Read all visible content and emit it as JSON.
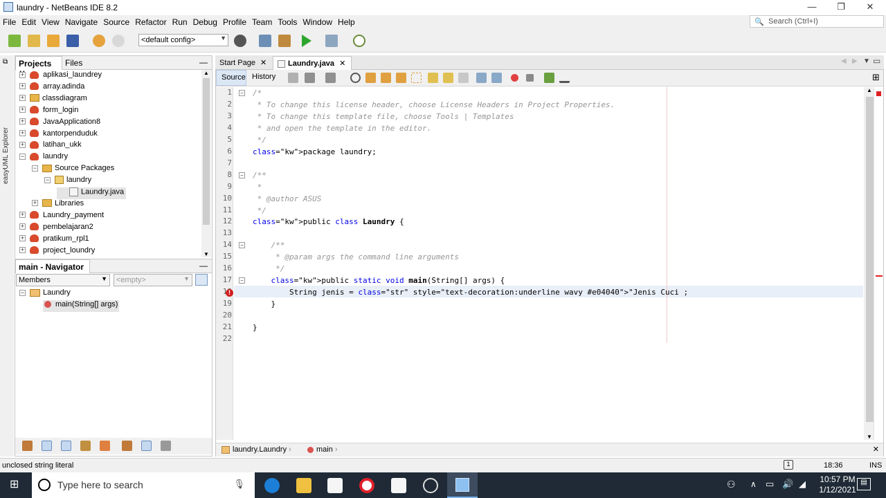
{
  "window": {
    "title": "laundry - NetBeans IDE 8.2"
  },
  "menu": [
    "File",
    "Edit",
    "View",
    "Navigate",
    "Source",
    "Refactor",
    "Run",
    "Debug",
    "Profile",
    "Team",
    "Tools",
    "Window",
    "Help"
  ],
  "search": {
    "placeholder": "Search (Ctrl+I)"
  },
  "toolbar": {
    "config": "<default config>"
  },
  "sidestrip": {
    "label": "easyUML Explorer"
  },
  "projects": {
    "tab_projects": "Projects",
    "tab_files": "Files",
    "tree": [
      {
        "label": "aplikasi_laundrey",
        "level": 0,
        "icon": "project-icon",
        "exp": "+"
      },
      {
        "label": "array.adinda",
        "level": 0,
        "icon": "project-icon",
        "exp": "+"
      },
      {
        "label": "classdiagram",
        "level": 0,
        "icon": "folder-icon",
        "exp": "+"
      },
      {
        "label": "form_login",
        "level": 0,
        "icon": "project-icon",
        "exp": "+"
      },
      {
        "label": "JavaApplication8",
        "level": 0,
        "icon": "project-icon",
        "exp": "+"
      },
      {
        "label": "kantorpenduduk",
        "level": 0,
        "icon": "project-icon",
        "exp": "+"
      },
      {
        "label": "latihan_ukk",
        "level": 0,
        "icon": "project-icon",
        "exp": "+"
      },
      {
        "label": "laundry",
        "level": 0,
        "icon": "project-icon",
        "exp": "−"
      },
      {
        "label": "Source Packages",
        "level": 1,
        "icon": "folder-icon",
        "exp": "−"
      },
      {
        "label": "laundry",
        "level": 2,
        "icon": "package-icon",
        "exp": "−"
      },
      {
        "label": "Laundry.java",
        "level": 3,
        "icon": "java-file-icon",
        "exp": ""
      },
      {
        "label": "Libraries",
        "level": 1,
        "icon": "folder-icon",
        "exp": "+"
      },
      {
        "label": "Laundry_payment",
        "level": 0,
        "icon": "project-icon",
        "exp": "+"
      },
      {
        "label": "pembelajaran2",
        "level": 0,
        "icon": "project-icon",
        "exp": "+"
      },
      {
        "label": "pratikum_rpl1",
        "level": 0,
        "icon": "project-icon",
        "exp": "+"
      },
      {
        "label": "project_loundry",
        "level": 0,
        "icon": "project-icon",
        "exp": "+"
      }
    ]
  },
  "navigator": {
    "title": "main - Navigator",
    "members": "Members",
    "filter": "<empty>",
    "class_name": "Laundry",
    "method": "main(String[] args)"
  },
  "editor": {
    "tab_start": "Start Page",
    "tab_file": "Laundry.java",
    "btn_source": "Source",
    "btn_history": "History",
    "code_lines": [
      "/*",
      " * To change this license header, choose License Headers in Project Properties.",
      " * To change this template file, choose Tools | Templates",
      " * and open the template in the editor.",
      " */",
      "package laundry;",
      "",
      "/**",
      " *",
      " * @author ASUS",
      " */",
      "public class Laundry {",
      "",
      "    /**",
      "     * @param args the command line arguments",
      "     */",
      "    public static void main(String[] args) {",
      "        String jenis = \"Jenis Cuci ;",
      "    }",
      "",
      "}",
      ""
    ],
    "line_numbers": [
      "1",
      "2",
      "3",
      "4",
      "5",
      "6",
      "7",
      "8",
      "9",
      "10",
      "11",
      "12",
      "13",
      "14",
      "15",
      "16",
      "17",
      "18",
      "19",
      "20",
      "21",
      "22"
    ]
  },
  "breadcrumb": {
    "cls": "laundry.Laundry",
    "method": "main"
  },
  "status": {
    "message": "unclosed string literal",
    "position": "18:36",
    "mode": "INS"
  },
  "taskbar": {
    "search_placeholder": "Type here to search",
    "time": "10:57 PM",
    "date": "1/12/2021"
  }
}
